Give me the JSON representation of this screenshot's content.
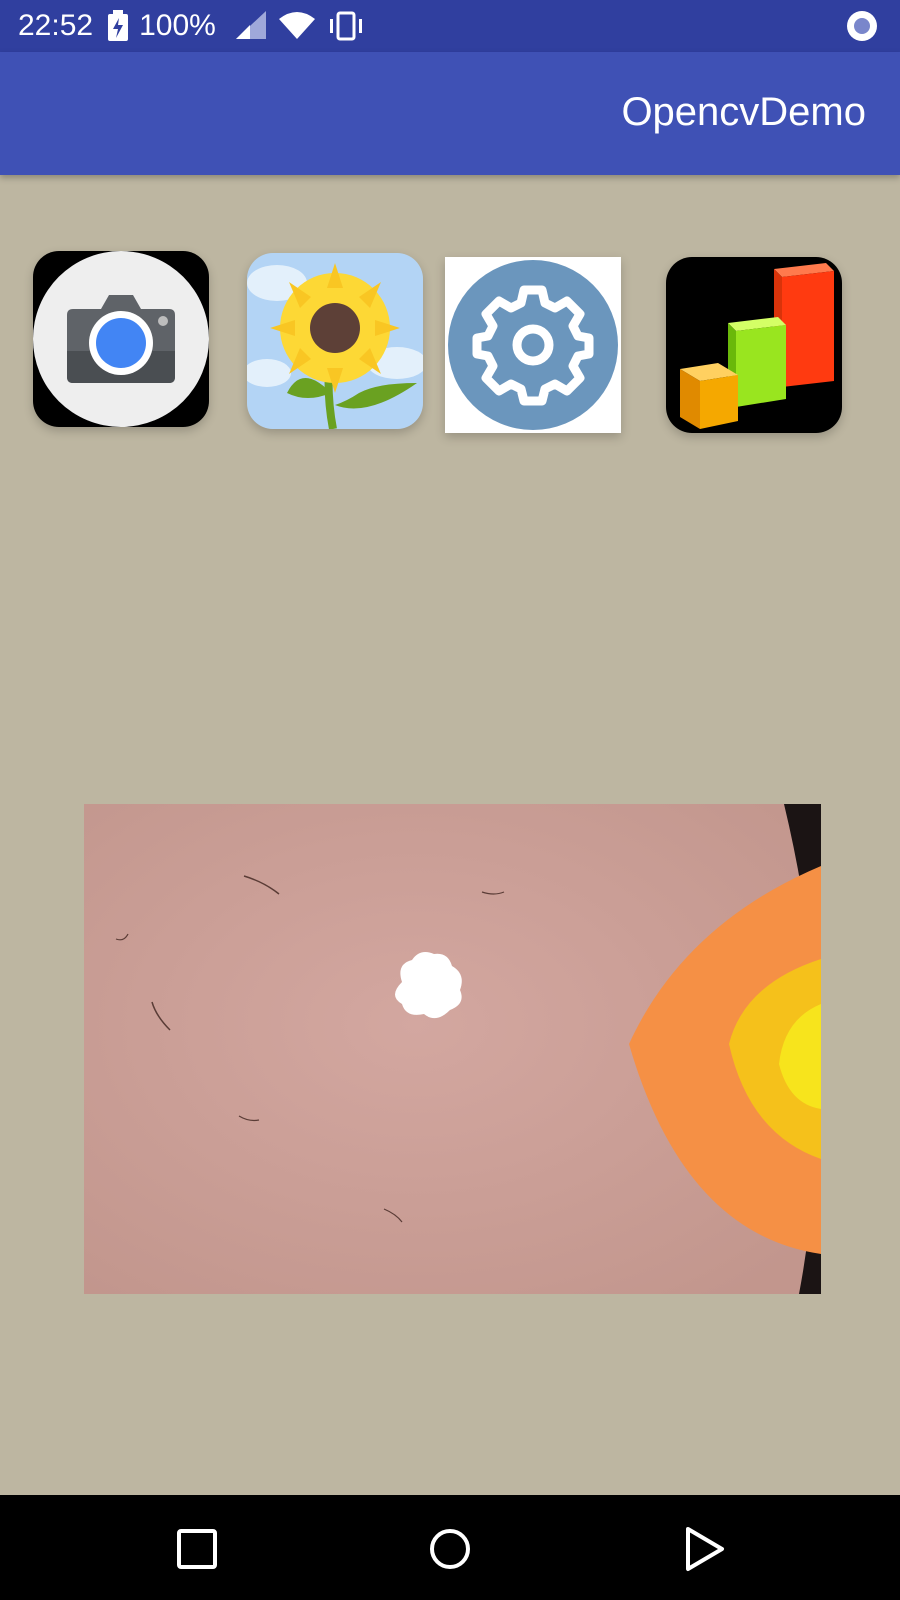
{
  "status_bar": {
    "time": "22:52",
    "battery_percent": "100%",
    "icons": [
      "battery-charging-icon",
      "signal-icon",
      "wifi-icon",
      "vibrate-icon",
      "notification-dot-icon"
    ]
  },
  "app_bar": {
    "title": "OpencvDemo",
    "color": "#3f51b5",
    "status_color": "#303f9f"
  },
  "toolbar_icons": [
    {
      "name": "camera-icon"
    },
    {
      "name": "sunflower-gallery-icon"
    },
    {
      "name": "settings-gear-icon"
    },
    {
      "name": "bar-chart-icon"
    }
  ],
  "result_image": {
    "description_icon": "skin-lesion-image"
  },
  "nav_bar": {
    "icons": [
      "recents-square-icon",
      "home-circle-icon",
      "back-triangle-icon"
    ]
  },
  "colors": {
    "background": "#bdb6a1"
  }
}
